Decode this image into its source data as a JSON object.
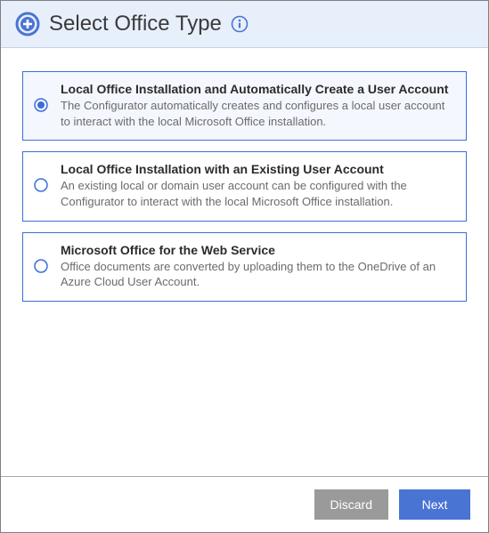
{
  "header": {
    "title": "Select Office Type"
  },
  "options": [
    {
      "title": "Local Office Installation and Automatically Create a User Account",
      "desc": "The Configurator automatically creates and configures a local user account to interact with the local Microsoft Office installation.",
      "selected": true
    },
    {
      "title": "Local Office Installation with an Existing User Account",
      "desc": "An existing local or domain user account can be configured with the Configurator to interact with the local Microsoft Office installation.",
      "selected": false
    },
    {
      "title": "Microsoft Office for the Web Service",
      "desc": "Office documents are converted by uploading them to the OneDrive of an Azure Cloud User Account.",
      "selected": false
    }
  ],
  "footer": {
    "discard_label": "Discard",
    "next_label": "Next"
  },
  "colors": {
    "accent": "#4a74d4",
    "header_bg": "#e7effb",
    "option_border": "#3a6fd8",
    "selected_bg": "#f4f7fd"
  }
}
